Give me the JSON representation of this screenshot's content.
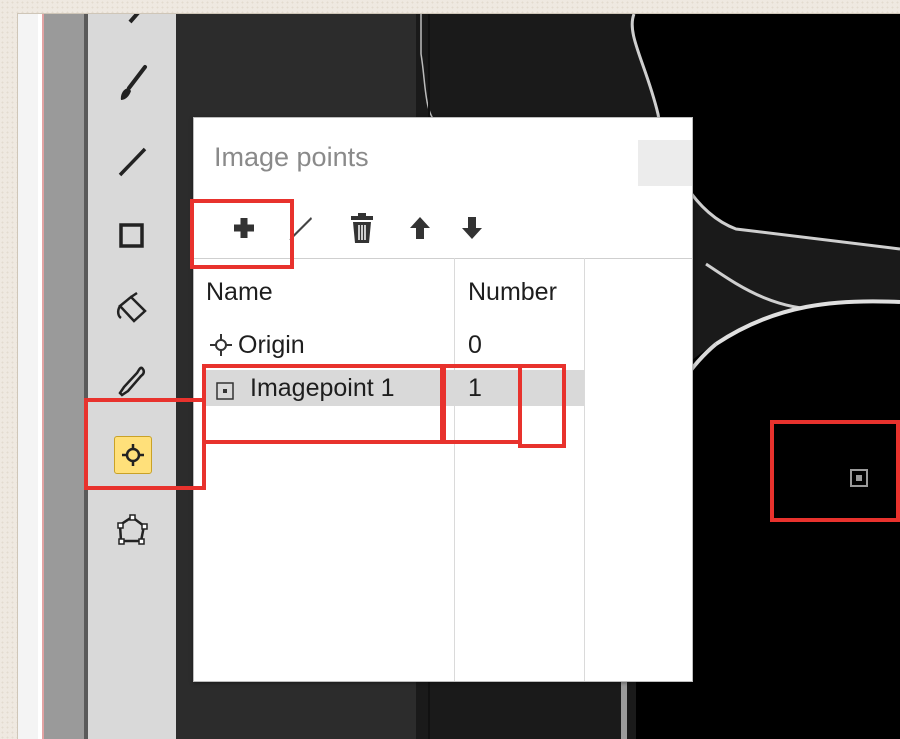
{
  "dialog": {
    "title": "Image points",
    "toolbar": {
      "add_icon": "plus-icon",
      "edit_icon": "pencil-icon",
      "delete_icon": "trash-icon",
      "up_icon": "arrow-up-icon",
      "down_icon": "arrow-down-icon"
    },
    "columns": [
      "Name",
      "Number"
    ],
    "rows": [
      {
        "name": "Origin",
        "number": "0",
        "icon": "crosshair-icon"
      },
      {
        "name": "Imagepoint 1",
        "number": "1",
        "icon": "point-square-icon",
        "selected": true
      }
    ]
  },
  "tools": [
    "brush-icon",
    "line-icon",
    "rectangle-icon",
    "fill-bucket-icon",
    "eyedropper-icon",
    "image-point-tool-icon",
    "polygon-icon"
  ],
  "colors": {
    "highlight": "#e8322d",
    "active_tool": "#ffe07a",
    "selection": "#d9d9d9"
  }
}
